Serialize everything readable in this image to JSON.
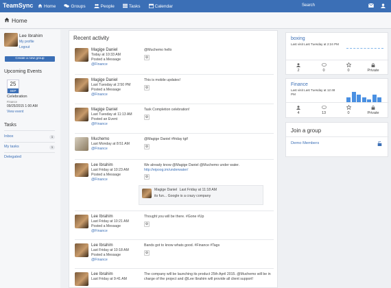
{
  "brand": "TeamSync",
  "nav": {
    "items": [
      {
        "label": "Home",
        "icon": "home-icon"
      },
      {
        "label": "Groups",
        "icon": "groups-icon"
      },
      {
        "label": "People",
        "icon": "people-icon"
      },
      {
        "label": "Tasks",
        "icon": "tasks-icon"
      },
      {
        "label": "Calendar",
        "icon": "calendar-icon"
      }
    ],
    "search_label": "Search",
    "right_icons": [
      "mail-icon",
      "user-icon"
    ]
  },
  "page_title": "Home",
  "user": {
    "name": "Lee Ibrahim",
    "profile_link": "My profile",
    "logout_link": "Logout",
    "create_group_button": "Create a new group"
  },
  "upcoming": {
    "heading": "Upcoming Events",
    "event": {
      "day": "25",
      "month": "SEP",
      "title": "Celebration",
      "group": "Finance",
      "datetime": "09/25/2015 1:00 AM",
      "view_link": "View event"
    }
  },
  "tasks": {
    "heading": "Tasks",
    "items": [
      {
        "label": "Inbox",
        "count": "1"
      },
      {
        "label": "My tasks",
        "count": "1"
      },
      {
        "label": "Delegated",
        "count": ""
      }
    ]
  },
  "activity": {
    "heading": "Recent activity",
    "items": [
      {
        "name": "Magige Daniel",
        "time": "Today at 10:33 AM",
        "action": "Posted a Message",
        "group": "@Finance",
        "message": "@Muchemo hello"
      },
      {
        "name": "Magige Daniel",
        "time": "Last Tuesday at 2:50 PM",
        "action": "Posted a Message",
        "group": "@Finance",
        "message": "This is mobile updates!"
      },
      {
        "name": "Magige Daniel",
        "time": "Last Tuesday at 11:13 AM",
        "action": "Posted an Event",
        "group": "@Finance",
        "message": "Task Completion celebration!"
      },
      {
        "name": "Muchemo",
        "time": "Last Monday at 8:51 AM",
        "action": "",
        "group": "@Finance",
        "message": "@Magige Daniel #friday tgif"
      },
      {
        "name": "Lee Ibrahim",
        "time": "Last Friday at 10:23 AM",
        "action": "Posted a Message",
        "group": "@Finance",
        "message": "We already know @Magige Daniel @Muchemo under water.",
        "link": "http://eipoog.im/underwater/",
        "reply": {
          "name": "Magige Daniel",
          "time": "Last Friday at 11:18 AM",
          "text": "its fun... Google is a crazy company"
        }
      },
      {
        "name": "Lee Ibrahim",
        "time": "Last Friday at 10:21 AM",
        "action": "Posted a Message",
        "group": "@Finance",
        "message": "Thought you will be there. #Gone #Up"
      },
      {
        "name": "Lee Ibrahim",
        "time": "Last Friday at 10:18 AM",
        "action": "Posted a Message",
        "group": "@Finance",
        "message": "Bands got to know whats good. #Finance #Tags"
      },
      {
        "name": "Lee Ibrahim",
        "time": "Last Friday at 9:41 AM",
        "action": "",
        "group": "",
        "message": "The company will be launching its product 25th April 2015. @Muchemo will be in charge of the project and @Lee Ibrahim will provide all client support!"
      }
    ]
  },
  "groups": [
    {
      "name": "boxing",
      "last_visit": "Last visit Last Tuesday at 2:24 PM",
      "members": "2",
      "messages": "0",
      "favorites": "0",
      "privacy": "Private",
      "chart_values": [
        0,
        0,
        0,
        0,
        0,
        0,
        0
      ]
    },
    {
      "name": "Finance",
      "last_visit": "Last visit Last Tuesday at 12:48 PM",
      "members": "4",
      "messages": "13",
      "favorites": "0",
      "privacy": "Private",
      "chart_values": [
        2,
        4,
        3,
        2,
        1,
        3,
        2
      ]
    }
  ],
  "join": {
    "heading": "Join a group",
    "group_name": "Demo Members"
  },
  "colors": {
    "primary": "#3b6fb6",
    "bars": "#4a90e2"
  }
}
